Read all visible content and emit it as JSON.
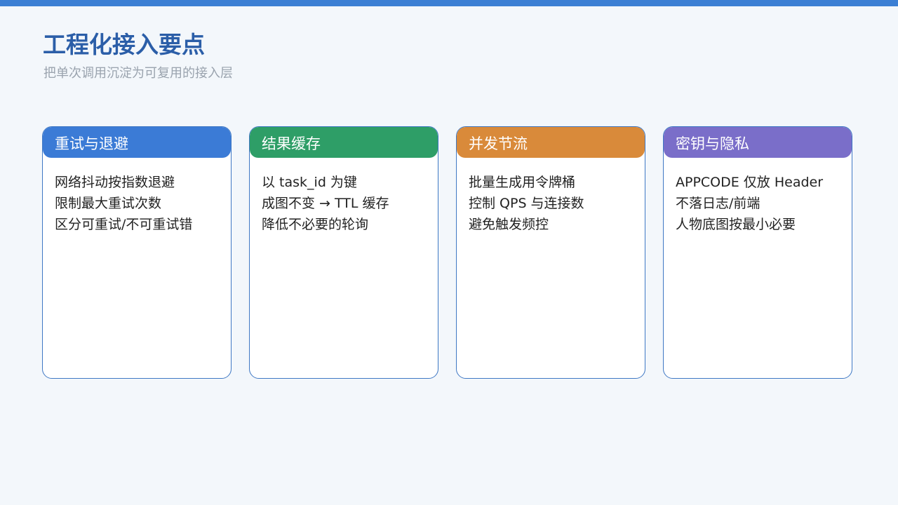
{
  "slide": {
    "title": "工程化接入要点",
    "subtitle": "把单次调用沉淀为可复用的接入层"
  },
  "colors": {
    "accent_bar": "#3b7fd4",
    "title": "#2b5ea8",
    "card_border": "#3f78c4"
  },
  "cards": [
    {
      "title": "重试与退避",
      "color": "#3b7bd6",
      "lines": [
        "网络抖动按指数退避",
        "限制最大重试次数",
        "区分可重试/不可重试错"
      ]
    },
    {
      "title": "结果缓存",
      "color": "#2e9e67",
      "lines": [
        "以 task_id 为键",
        "成图不变 → TTL 缓存",
        "降低不必要的轮询"
      ]
    },
    {
      "title": "并发节流",
      "color": "#d98a3a",
      "lines": [
        "批量生成用令牌桶",
        "控制 QPS 与连接数",
        "避免触发频控"
      ]
    },
    {
      "title": "密钥与隐私",
      "color": "#7a6ec9",
      "lines": [
        "APPCODE 仅放 Header",
        "不落日志/前端",
        "人物底图按最小必要"
      ]
    }
  ]
}
